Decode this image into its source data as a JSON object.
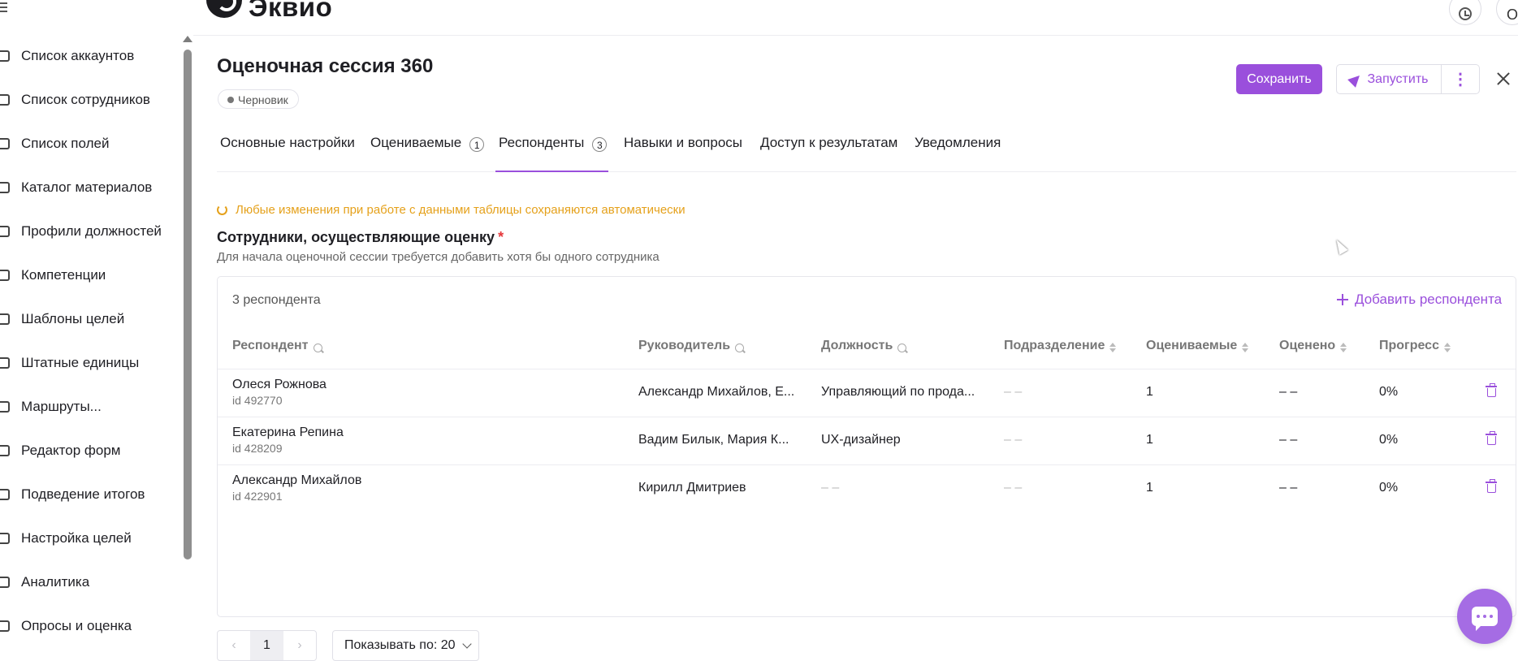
{
  "sidebar": {
    "items": [
      {
        "label": "Список аккаунтов"
      },
      {
        "label": "Список сотрудников"
      },
      {
        "label": "Список полей"
      },
      {
        "label": "Каталог материалов"
      },
      {
        "label": "Профили должностей"
      },
      {
        "label": "Компетенции"
      },
      {
        "label": "Шаблоны целей"
      },
      {
        "label": "Штатные единицы"
      },
      {
        "label": "Маршруты..."
      },
      {
        "label": "Редактор форм"
      },
      {
        "label": "Подведение итогов"
      },
      {
        "label": "Настройка целей"
      },
      {
        "label": "Аналитика"
      },
      {
        "label": "Опросы и оценка"
      }
    ]
  },
  "header": {
    "logo_text": "Эквио",
    "avatar_letter": "О"
  },
  "page": {
    "title": "Оценочная сессия 360",
    "status": "Черновик",
    "save_label": "Сохранить",
    "launch_label": "Запустить",
    "more_label": "⋮"
  },
  "tabs": [
    {
      "label": "Основные настройки",
      "count": null
    },
    {
      "label": "Оцениваемые",
      "count": "1"
    },
    {
      "label": "Респонденты",
      "count": "3",
      "active": true
    },
    {
      "label": "Навыки и вопросы",
      "count": null
    },
    {
      "label": "Доступ к результатам",
      "count": null
    },
    {
      "label": "Уведомления",
      "count": null
    }
  ],
  "notice": "Любые изменения при работе с данными таблицы сохраняются автоматически",
  "section": {
    "title": "Сотрудники, осуществляющие оценку",
    "required_mark": "*",
    "subtitle": "Для начала оценочной сессии требуется добавить хотя бы одного сотрудника"
  },
  "table": {
    "count_label": "3 респондента",
    "add_label": "Добавить респондента",
    "headers": {
      "respondent": "Респондент",
      "manager": "Руководитель",
      "position": "Должность",
      "department": "Подразделение",
      "evaluated": "Оцениваемые",
      "rated": "Оценено",
      "progress": "Прогресс"
    },
    "rows": [
      {
        "name": "Олеся Рожнова",
        "id": "id 492770",
        "manager": "Александр Михайлов, Е...",
        "position": "Управляющий по прода...",
        "department": "– –",
        "evaluated": "1",
        "rated": "– –",
        "progress": "0%"
      },
      {
        "name": "Екатерина Репина",
        "id": "id 428209",
        "manager": "Вадим Билык, Мария К...",
        "position": "UX-дизайнер",
        "department": "– –",
        "evaluated": "1",
        "rated": "– –",
        "progress": "0%"
      },
      {
        "name": "Александр Михайлов",
        "id": "id 422901",
        "manager": "Кирилл Дмитриев",
        "position": "– –",
        "department": "– –",
        "evaluated": "1",
        "rated": "– –",
        "progress": "0%"
      }
    ]
  },
  "pagination": {
    "prev": "‹",
    "current": "1",
    "next": "›",
    "page_size_label": "Показывать по: 20"
  },
  "colors": {
    "accent": "#9a4fdc",
    "warning": "#e5a11b",
    "required": "#e5383b"
  }
}
